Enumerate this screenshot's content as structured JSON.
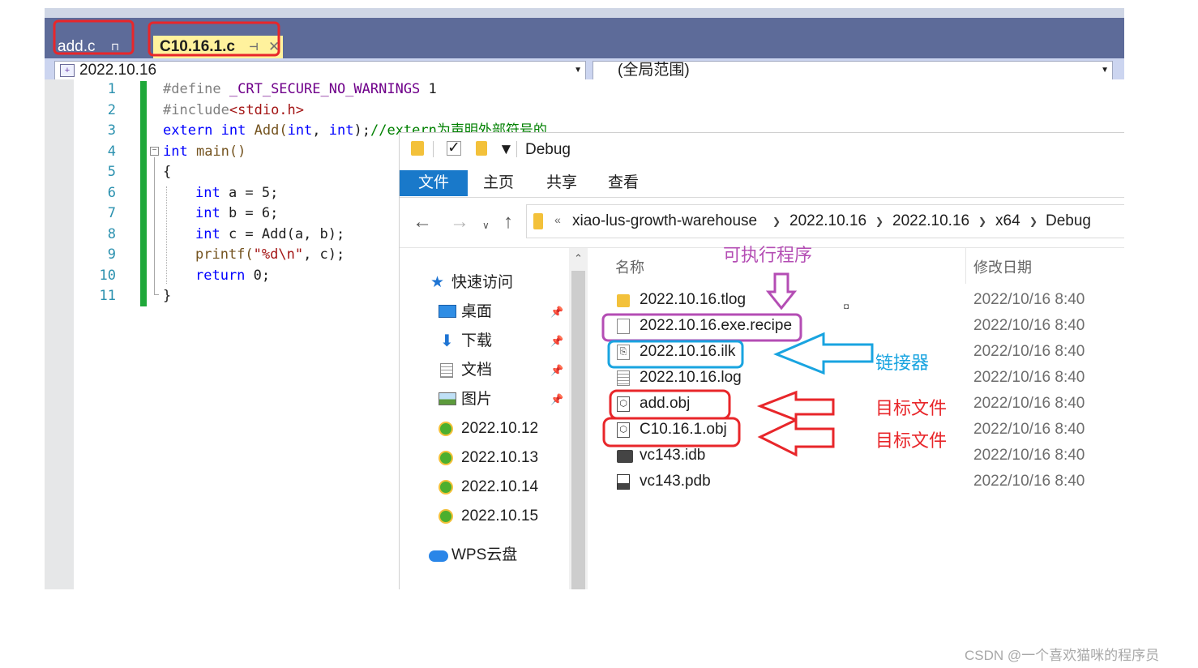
{
  "vs": {
    "tabs": [
      {
        "label": "add.c",
        "pin": "⊓"
      },
      {
        "label": "C10.16.1.c",
        "pin": "⊣",
        "close": "✕"
      }
    ],
    "nav": {
      "project": "2022.10.16",
      "scope": "(全局范围)"
    },
    "line_numbers": [
      "1",
      "2",
      "3",
      "4",
      "5",
      "6",
      "7",
      "8",
      "9",
      "10",
      "11"
    ],
    "code": {
      "l1a": "#define",
      "l1b": " _CRT_SECURE_NO_WARNINGS",
      "l1c": " 1",
      "l2a": "#include",
      "l2b": "<stdio.h>",
      "l3a": "extern",
      "l3b": " ",
      "l3c": "int",
      "l3d": " Add(",
      "l3e": "int",
      "l3f": ", ",
      "l3g": "int",
      "l3h": ");",
      "l3i": "//extern为声明外部符号的",
      "l4a": "int",
      "l4b": " main()",
      "l5": "{",
      "l6a": "int",
      "l6b": " a = 5;",
      "l7a": "int",
      "l7b": " b = 6;",
      "l8a": "int",
      "l8b": " c = Add(a, b);",
      "l9a": "printf(",
      "l9b": "\"%d\\n\"",
      "l9c": ", c);",
      "l10a": "return",
      "l10b": " 0;",
      "l11": "}"
    }
  },
  "explorer": {
    "title": "Debug",
    "ribbon_tabs": [
      "文件",
      "主页",
      "共享",
      "查看"
    ],
    "breadcrumb": [
      "xiao-lus-growth-warehouse",
      "2022.10.16",
      "2022.10.16",
      "x64",
      "Debug"
    ],
    "nav_items": [
      {
        "label": "快速访问",
        "icon": "star-icon"
      },
      {
        "label": "桌面",
        "icon": "desktop-icon",
        "pinned": true
      },
      {
        "label": "下载",
        "icon": "download-icon",
        "pinned": true
      },
      {
        "label": "文档",
        "icon": "document-icon",
        "pinned": true
      },
      {
        "label": "图片",
        "icon": "picture-icon",
        "pinned": true
      },
      {
        "label": "2022.10.12",
        "icon": "folder-sync-icon"
      },
      {
        "label": "2022.10.13",
        "icon": "folder-sync-icon"
      },
      {
        "label": "2022.10.14",
        "icon": "folder-sync-icon"
      },
      {
        "label": "2022.10.15",
        "icon": "folder-sync-icon"
      },
      {
        "label": "WPS云盘",
        "icon": "cloud-icon"
      }
    ],
    "columns": {
      "name": "名称",
      "date": "修改日期"
    },
    "files": [
      {
        "name": "2022.10.16.tlog",
        "date": "2022/10/16 8:40",
        "icon": "folder-icon"
      },
      {
        "name": "2022.10.16.exe.recipe",
        "date": "2022/10/16 8:40",
        "icon": "file-icon"
      },
      {
        "name": "2022.10.16.ilk",
        "date": "2022/10/16 8:40",
        "icon": "ilk-file-icon"
      },
      {
        "name": "2022.10.16.log",
        "date": "2022/10/16 8:40",
        "icon": "text-file-icon"
      },
      {
        "name": "add.obj",
        "date": "2022/10/16 8:40",
        "icon": "obj-file-icon"
      },
      {
        "name": "C10.16.1.obj",
        "date": "2022/10/16 8:40",
        "icon": "obj-file-icon"
      },
      {
        "name": "vc143.idb",
        "date": "2022/10/16 8:40",
        "icon": "idb-file-icon"
      },
      {
        "name": "vc143.pdb",
        "date": "2022/10/16 8:40",
        "icon": "pdb-file-icon"
      }
    ]
  },
  "annotations": {
    "exe_label": "可执行程序",
    "linker_label": "链接器",
    "obj_label_1": "目标文件",
    "obj_label_2": "目标文件",
    "colors": {
      "purple": "#b44db4",
      "blue": "#19a4e0",
      "red": "#e8262a"
    }
  },
  "watermark": "CSDN @一个喜欢猫咪的程序员"
}
